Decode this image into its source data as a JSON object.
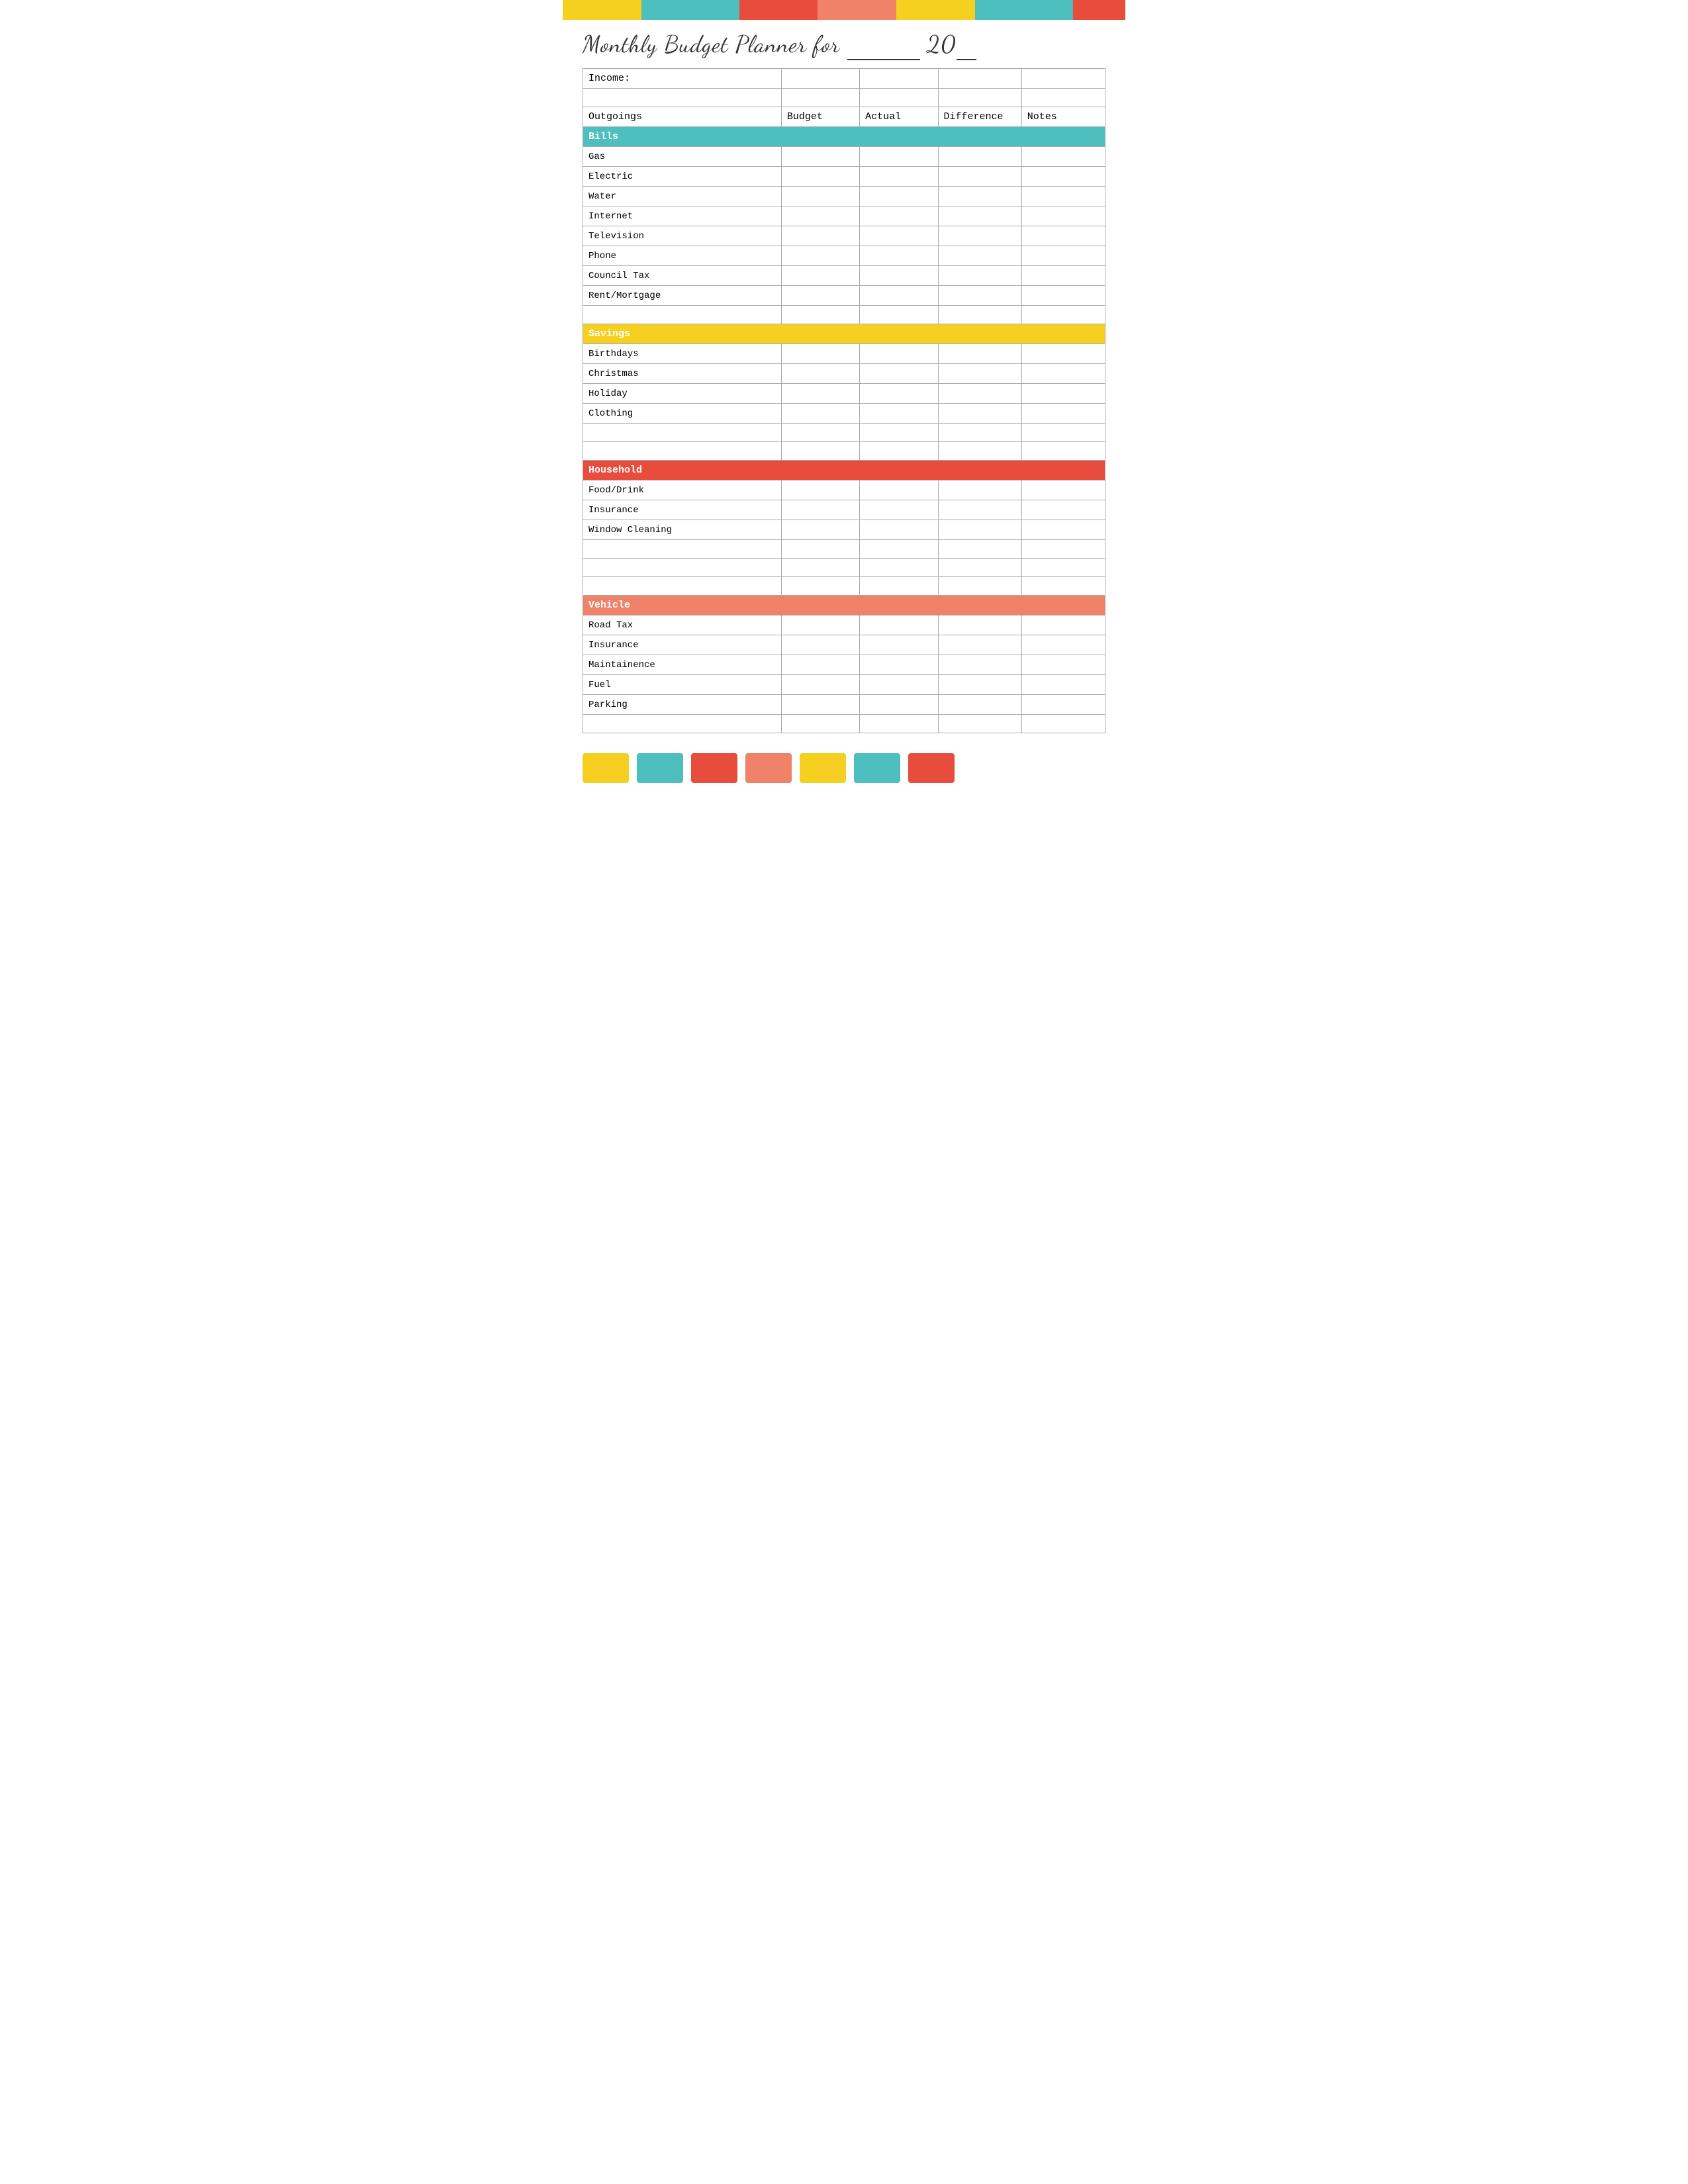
{
  "header": {
    "title": "Monthly Budget Planner for __________ 20__",
    "color_bar": [
      {
        "color": "#f5d020",
        "name": "yellow"
      },
      {
        "color": "#4dbfbf",
        "name": "teal"
      },
      {
        "color": "#e84c3d",
        "name": "red"
      },
      {
        "color": "#f0826a",
        "name": "salmon"
      },
      {
        "color": "#f5d020",
        "name": "yellow2"
      },
      {
        "color": "#4dbfbf",
        "name": "teal2"
      },
      {
        "color": "#e84c3d",
        "name": "red2"
      }
    ]
  },
  "table": {
    "income_label": "Income:",
    "columns": {
      "outgoings": "Outgoings",
      "budget": "Budget",
      "actual": "Actual",
      "difference": "Difference",
      "notes": "Notes"
    },
    "sections": [
      {
        "name": "Bills",
        "color": "#4dbfbf",
        "class": "bills",
        "items": [
          "Gas",
          "Electric",
          "Water",
          "Internet",
          "Television",
          "Phone",
          "Council Tax",
          "Rent/Mortgage"
        ]
      },
      {
        "name": "Savings",
        "color": "#f5d020",
        "class": "savings",
        "items": [
          "Birthdays",
          "Christmas",
          "Holiday",
          "Clothing"
        ]
      },
      {
        "name": "Household",
        "color": "#e84c3d",
        "class": "household",
        "items": [
          "Food/Drink",
          "Insurance",
          "Window Cleaning"
        ]
      },
      {
        "name": "Vehicle",
        "color": "#f0826a",
        "class": "vehicle",
        "items": [
          "Road Tax",
          "Insurance",
          "Maintainence",
          "Fuel",
          "Parking"
        ]
      }
    ]
  },
  "footer": {
    "color_bar": [
      {
        "color": "#f5d020",
        "name": "yellow"
      },
      {
        "color": "#4dbfbf",
        "name": "teal"
      },
      {
        "color": "#e84c3d",
        "name": "red"
      },
      {
        "color": "#f0826a",
        "name": "salmon"
      },
      {
        "color": "#f5d020",
        "name": "yellow2"
      },
      {
        "color": "#4dbfbf",
        "name": "teal2"
      },
      {
        "color": "#e84c3d",
        "name": "red2"
      }
    ]
  }
}
